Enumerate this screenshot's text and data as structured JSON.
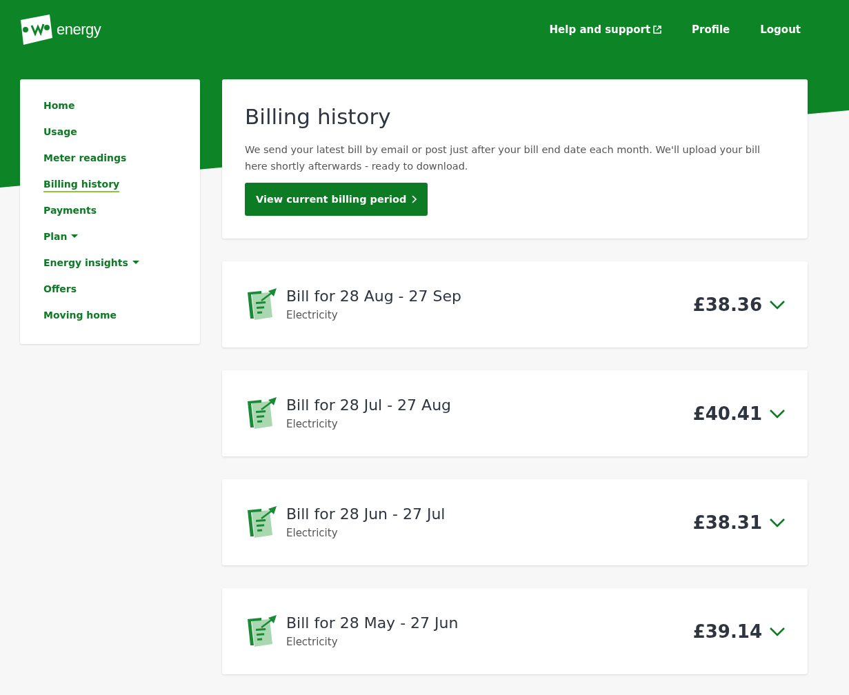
{
  "header": {
    "logo_text": "energy",
    "links": [
      {
        "label": "Help and support",
        "external": true
      },
      {
        "label": "Profile",
        "external": false
      },
      {
        "label": "Logout",
        "external": false
      }
    ]
  },
  "sidebar": {
    "items": [
      {
        "label": "Home",
        "selected": false,
        "has_menu": false
      },
      {
        "label": "Usage",
        "selected": false,
        "has_menu": false
      },
      {
        "label": "Meter readings",
        "selected": false,
        "has_menu": false
      },
      {
        "label": "Billing history",
        "selected": true,
        "has_menu": false
      },
      {
        "label": "Payments",
        "selected": false,
        "has_menu": false
      },
      {
        "label": "Plan",
        "selected": false,
        "has_menu": true
      },
      {
        "label": "Energy insights",
        "selected": false,
        "has_menu": true
      },
      {
        "label": "Offers",
        "selected": false,
        "has_menu": false
      },
      {
        "label": "Moving home",
        "selected": false,
        "has_menu": false
      }
    ]
  },
  "intro": {
    "title": "Billing history",
    "text": "We send your latest bill by email or post just after your bill end date each month. We'll upload your bill here shortly afterwards - ready to download.",
    "button": "View current billing period"
  },
  "bills": [
    {
      "title": "Bill for 28 Aug - 27 Sep",
      "fuel": "Electricity",
      "amount": "£38.36",
      "expanded": false
    },
    {
      "title": "Bill for 28 Jul - 27 Aug",
      "fuel": "Electricity",
      "amount": "£40.41",
      "expanded": false
    },
    {
      "title": "Bill for 28 Jun - 27 Jul",
      "fuel": "Electricity",
      "amount": "£38.31",
      "expanded": false
    },
    {
      "title": "Bill for 28 May - 27 Jun",
      "fuel": "Electricity",
      "amount": "£39.14",
      "expanded": false
    }
  ]
}
